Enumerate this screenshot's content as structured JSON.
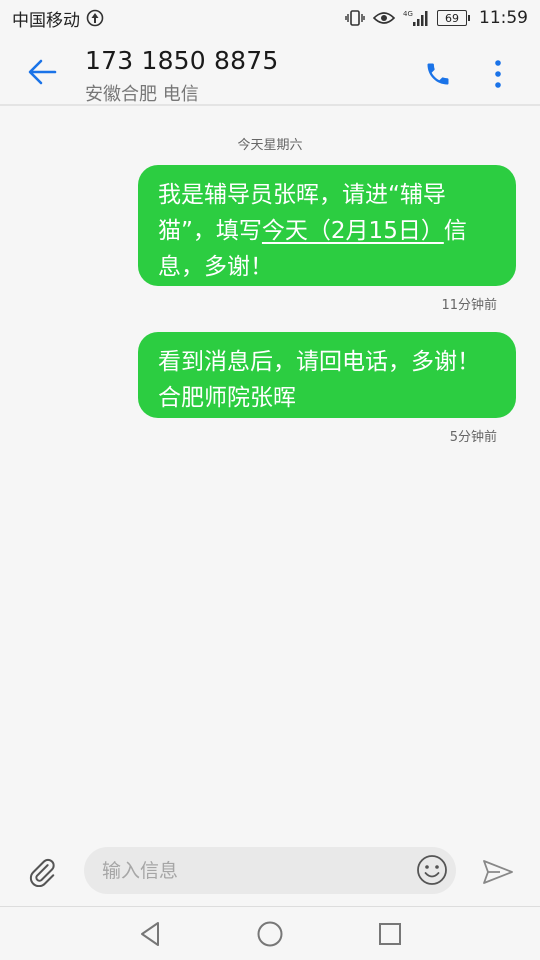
{
  "status_bar": {
    "carrier": "中国移动",
    "network_type": "4G",
    "battery_level": "69",
    "time": "11:59"
  },
  "header": {
    "number": "173 1850 8875",
    "location": "安徽合肥 电信",
    "icons": {
      "back": "back-arrow-icon",
      "call": "phone-icon",
      "more": "more-vert-icon"
    },
    "accent_color": "#1a73e8"
  },
  "conversation": {
    "date_label": "今天星期六",
    "messages": [
      {
        "text_before": "我是辅导员张晖，请进“辅导猫”，填写",
        "link_text": "今天（2月15日）",
        "text_after": "信息，多谢！",
        "time": "11分钟前"
      },
      {
        "text": "看到消息后，请回电话，多谢！合肥师院张晖",
        "time": "5分钟前"
      }
    ],
    "bubble_color": "#2ccd41"
  },
  "input_bar": {
    "placeholder": "输入信息",
    "value": "",
    "icons": {
      "attach": "paperclip-icon",
      "emoji": "emoji-icon",
      "send": "send-icon"
    }
  },
  "nav_bar": {
    "icons": [
      "nav-back-icon",
      "nav-home-icon",
      "nav-recents-icon"
    ]
  }
}
